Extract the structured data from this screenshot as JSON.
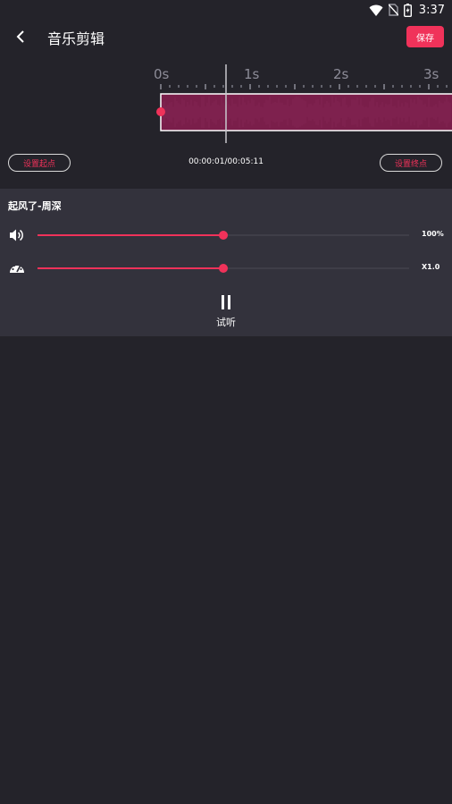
{
  "status_bar": {
    "time": "3:37",
    "icons": [
      "wifi-icon",
      "no-sim-icon",
      "battery-icon"
    ]
  },
  "app_bar": {
    "back_icon": "chevron-left-icon",
    "title": "音乐剪辑",
    "save_label": "保存"
  },
  "timeline": {
    "ruler_labels": [
      "0s",
      "1s",
      "2s",
      "3s"
    ],
    "current_time": "00:00:01",
    "total_time": "00:05:11",
    "time_display": "00:00:01/00:05:11",
    "set_start_label": "设置起点",
    "set_end_label": "设置终点"
  },
  "audio": {
    "song_title": "起风了-周深",
    "volume_label": "100%",
    "volume_fraction": 0.5,
    "speed_label": "X1.0",
    "speed_fraction": 0.5,
    "play_label": "试听"
  },
  "colors": {
    "accent": "#f0325a",
    "background": "#24232a",
    "panel": "#33323c",
    "waveform": "#7a1e4a"
  }
}
